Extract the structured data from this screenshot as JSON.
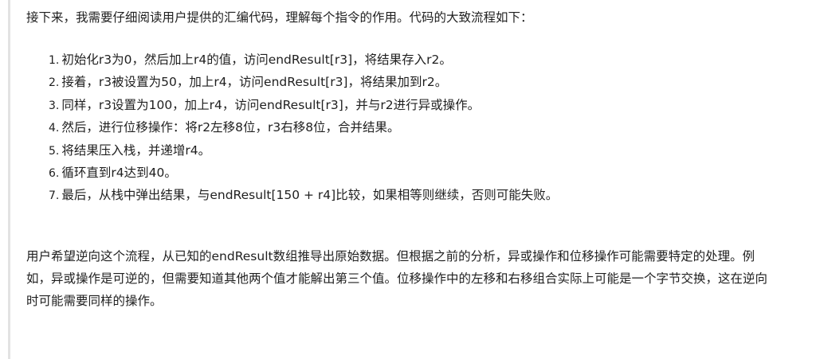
{
  "intro": "接下来，我需要仔细阅读用户提供的汇编代码，理解每个指令的作用。代码的大致流程如下：",
  "steps": [
    {
      "num": "1.",
      "text": "初始化r3为0，然后加上r4的值，访问endResult[r3]，将结果存入r2。"
    },
    {
      "num": "2.",
      "text": "接着，r3被设置为50，加上r4，访问endResult[r3]，将结果加到r2。"
    },
    {
      "num": "3.",
      "text": "同样，r3设置为100，加上r4，访问endResult[r3]，并与r2进行异或操作。"
    },
    {
      "num": "4.",
      "text": "然后，进行位移操作：将r2左移8位，r3右移8位，合并结果。"
    },
    {
      "num": "5.",
      "text": "将结果压入栈，并递增r4。"
    },
    {
      "num": "6.",
      "text": "循环直到r4达到40。"
    },
    {
      "num": "7.",
      "text": "最后，从栈中弹出结果，与endResult[150 + r4]比较，如果相等则继续，否则可能失败。"
    }
  ],
  "closing": "用户希望逆向这个流程，从已知的endResult数组推导出原始数据。但根据之前的分析，异或操作和位移操作可能需要特定的处理。例如，异或操作是可逆的，但需要知道其他两个值才能解出第三个值。位移操作中的左移和右移组合实际上可能是一个字节交换，这在逆向时可能需要同样的操作。"
}
